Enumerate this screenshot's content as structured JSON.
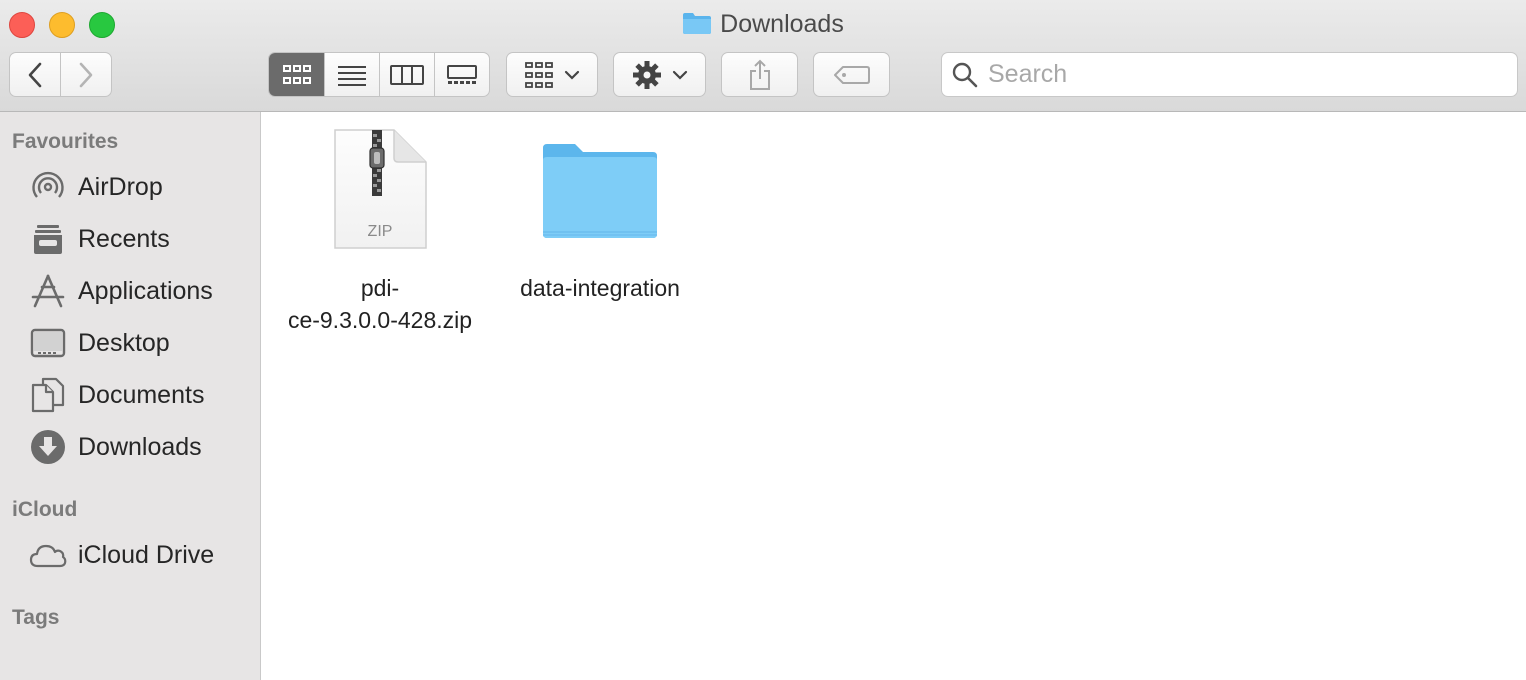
{
  "window": {
    "title": "Downloads"
  },
  "toolbar": {
    "search_placeholder": "Search"
  },
  "sidebar": {
    "sections": [
      {
        "heading": "Favourites"
      },
      {
        "heading": "iCloud"
      },
      {
        "heading": "Tags"
      }
    ],
    "favourites": [
      {
        "label": "AirDrop",
        "icon": "airdrop-icon"
      },
      {
        "label": "Recents",
        "icon": "recents-icon"
      },
      {
        "label": "Applications",
        "icon": "applications-icon"
      },
      {
        "label": "Desktop",
        "icon": "desktop-icon"
      },
      {
        "label": "Documents",
        "icon": "documents-icon"
      },
      {
        "label": "Downloads",
        "icon": "downloads-icon"
      }
    ],
    "icloud": [
      {
        "label": "iCloud Drive",
        "icon": "cloud-icon"
      }
    ]
  },
  "files": [
    {
      "name_line1": "pdi-",
      "name_line2": "ce-9.3.0.0-428.zip",
      "badge": "ZIP",
      "icon": "zip-file-icon"
    },
    {
      "name_line1": "data-integration",
      "icon": "folder-icon"
    }
  ]
}
